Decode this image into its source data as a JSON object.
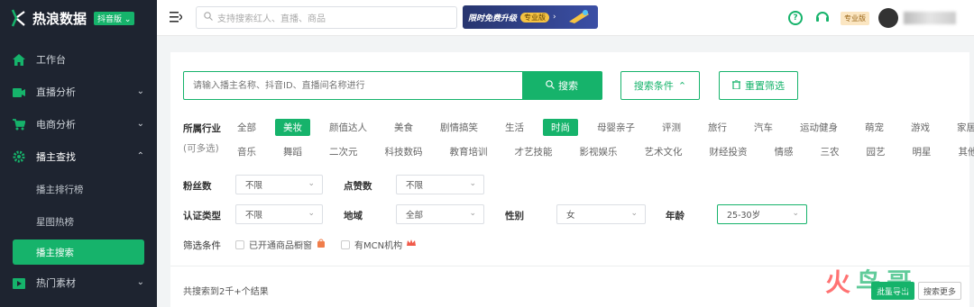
{
  "app": {
    "name": "热浪数据",
    "version_tag": "抖音版",
    "brand_color": "#16b36b"
  },
  "sidebar": {
    "items": [
      {
        "label": "工作台",
        "icon": "home-icon"
      },
      {
        "label": "直播分析",
        "icon": "video-icon"
      },
      {
        "label": "电商分析",
        "icon": "cart-icon"
      },
      {
        "label": "播主查找",
        "icon": "gear-icon"
      },
      {
        "label": "热门素材",
        "icon": "media-icon"
      }
    ],
    "subitems": [
      "播主排行榜",
      "星图热榜",
      "播主搜索"
    ]
  },
  "topbar": {
    "search_placeholder": "支持搜索红人、直播、商品",
    "banner_text": "限时免费升级",
    "banner_tag": "专业版",
    "plan_badge": "专业版"
  },
  "search": {
    "placeholder": "请输入播主名称、抖音ID、直播间名称进行",
    "button": "搜索",
    "conditions_button": "搜索条件",
    "reset_button": "重置筛选"
  },
  "industry": {
    "label": "所属行业",
    "hint": "(可多选)",
    "row1": [
      "全部",
      "美妆",
      "颜值达人",
      "美食",
      "剧情搞笑",
      "生活",
      "时尚",
      "母婴亲子",
      "评测",
      "旅行",
      "汽车",
      "运动健身",
      "萌宠",
      "游戏",
      "家居家装"
    ],
    "row2": [
      "音乐",
      "舞蹈",
      "二次元",
      "科技数码",
      "教育培训",
      "才艺技能",
      "影视娱乐",
      "艺术文化",
      "财经投资",
      "情感",
      "三农",
      "园艺",
      "明星",
      "其他"
    ]
  },
  "filters": {
    "fans_label": "粉丝数",
    "fans_value": "不限",
    "likes_label": "点赞数",
    "likes_value": "不限",
    "cert_label": "认证类型",
    "cert_value": "不限",
    "region_label": "地域",
    "region_value": "全部",
    "gender_label": "性别",
    "gender_value": "女",
    "age_label": "年龄",
    "age_value": "25-30岁"
  },
  "conditions": {
    "label": "筛选条件",
    "opt1": "已开通商品橱窗",
    "opt2": "有MCN机构"
  },
  "results": {
    "text": "共搜索到2千+个结果",
    "btn1": "批量导出",
    "btn2": "搜索更多"
  },
  "watermark": {
    "t1": "火",
    "t2": "鸟",
    "t3": "哥"
  }
}
